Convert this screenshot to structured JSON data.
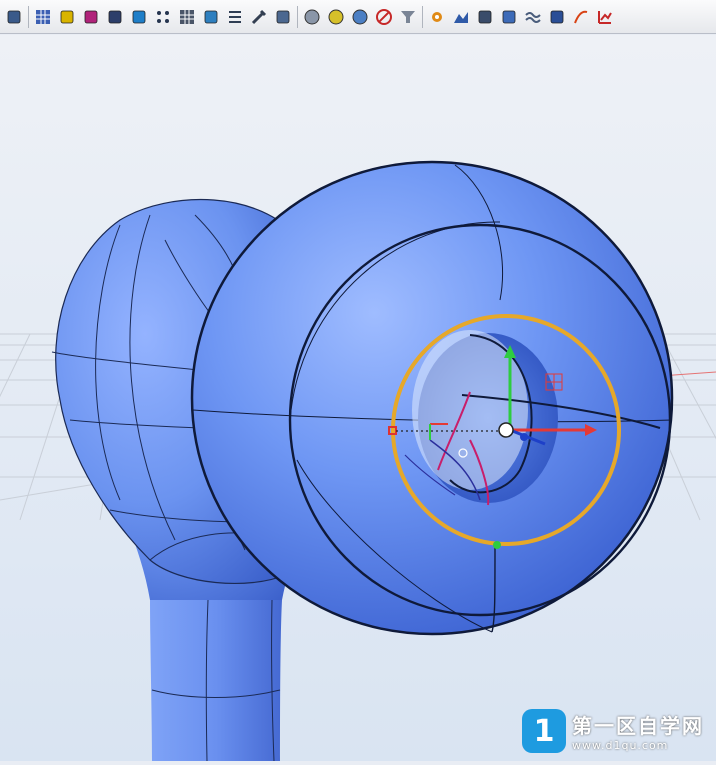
{
  "toolbar": {
    "buttons": [
      {
        "icon": "paint-brush-icon",
        "color": "#3a5a8a"
      },
      {
        "icon": "mesh-grid-icon",
        "color": "#3b5fb3"
      },
      {
        "icon": "cube-yellow-icon",
        "color": "#d9b400"
      },
      {
        "icon": "cube-wireframe-icon",
        "color": "#b0237a"
      },
      {
        "icon": "dimension-icon",
        "color": "#2c3e6a"
      },
      {
        "icon": "solid-box-icon",
        "color": "#1e7ec8"
      },
      {
        "icon": "control-points-icon",
        "color": "#25344f"
      },
      {
        "icon": "grid-select-icon",
        "color": "#4a5568"
      },
      {
        "icon": "surface-strip-icon",
        "color": "#2e7fbf"
      },
      {
        "icon": "list-icon",
        "color": "#2f3e54"
      },
      {
        "icon": "wrench-icon",
        "color": "#333f52"
      },
      {
        "icon": "group-icon",
        "color": "#4c6890"
      },
      {
        "icon": "sphere-gray-icon",
        "color": "#8a96a8"
      },
      {
        "icon": "sphere-yellow-icon",
        "color": "#d6c02a"
      },
      {
        "icon": "sphere-blue-icon",
        "color": "#4b7fc4"
      },
      {
        "icon": "no-entry-icon",
        "color": "#c62828"
      },
      {
        "icon": "funnel-icon",
        "color": "#7a8596"
      },
      {
        "icon": "gear-puzzle-icon",
        "color": "#e08a16"
      },
      {
        "icon": "terrain-icon",
        "color": "#2f5aa8"
      },
      {
        "icon": "layers-icon",
        "color": "#3a4c6a"
      },
      {
        "icon": "book-icon",
        "color": "#3d6bb8"
      },
      {
        "icon": "wave-icon",
        "color": "#4a5d7c"
      },
      {
        "icon": "panel-icon",
        "color": "#2a4e96"
      },
      {
        "icon": "draw-curve-icon",
        "color": "#d84315"
      },
      {
        "icon": "chart-arrows-icon",
        "color": "#c62828"
      }
    ]
  },
  "viewport": {
    "background_top": "#e9edf4",
    "background_bottom": "#d8e3f2",
    "model_color": "#6d95f2",
    "model_dark": "#3f67d6",
    "highlight_ring_color": "#e6a82a",
    "axis_x_color": "#e53935",
    "axis_y_color": "#2ecc40",
    "axis_z_color": "#1e40c8"
  },
  "watermark": {
    "logo_text": "1",
    "title": "第一区自学网",
    "url": "www.d1qu.com"
  }
}
